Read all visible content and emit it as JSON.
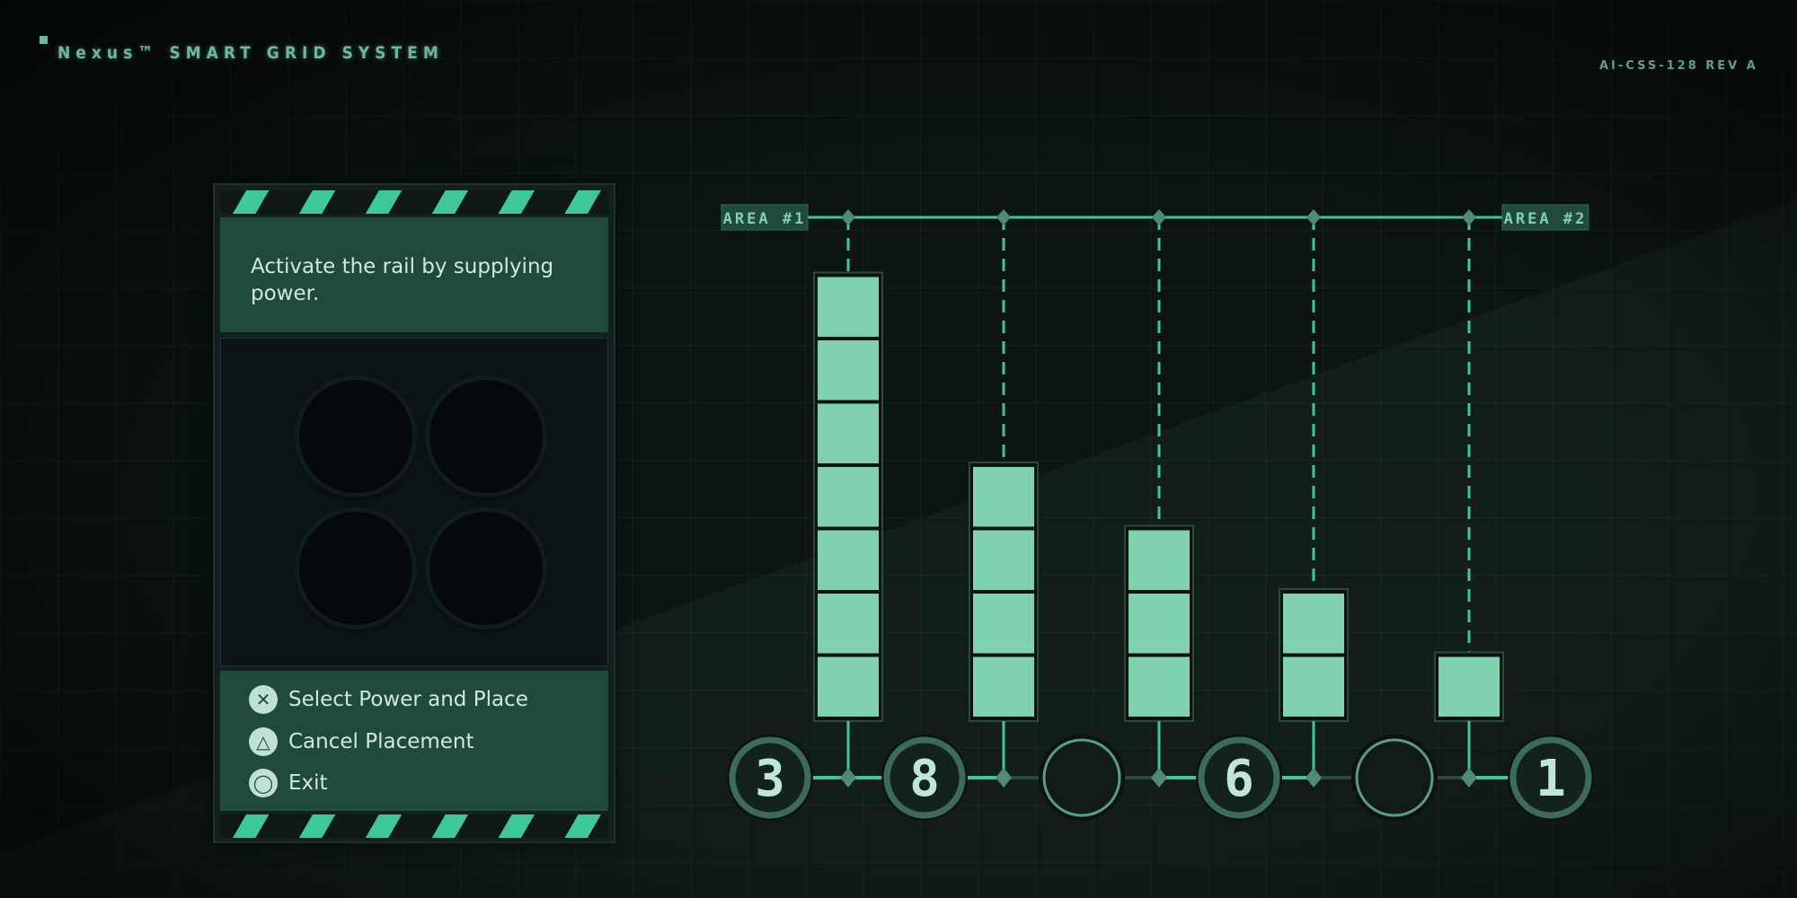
{
  "header": {
    "title": "Nexus™ SMART GRID SYSTEM",
    "code": "AI-CSS-128 REV A"
  },
  "panel": {
    "instruction": "Activate the rail by supplying power.",
    "power_slots": 4,
    "controls": [
      {
        "icon": "cross-button-icon",
        "glyph": "✕",
        "label": "Select Power and Place"
      },
      {
        "icon": "triangle-button-icon",
        "glyph": "△",
        "label": "Cancel Placement"
      },
      {
        "icon": "circle-button-icon",
        "glyph": "◯",
        "label": "Exit"
      }
    ]
  },
  "grid": {
    "start_label": "AREA #1",
    "end_label": "AREA #2",
    "columns": [
      {
        "cells": 7
      },
      {
        "cells": 4
      },
      {
        "cells": 3
      },
      {
        "cells": 2
      },
      {
        "cells": 1
      }
    ],
    "nodes": [
      "3",
      "8",
      "",
      "6",
      "",
      "1"
    ],
    "colors": {
      "accent": "#3ec797",
      "cell": "#7fd1b0",
      "rail_dim": "#2a4a40",
      "node_ring": "#3d6b5b"
    }
  }
}
